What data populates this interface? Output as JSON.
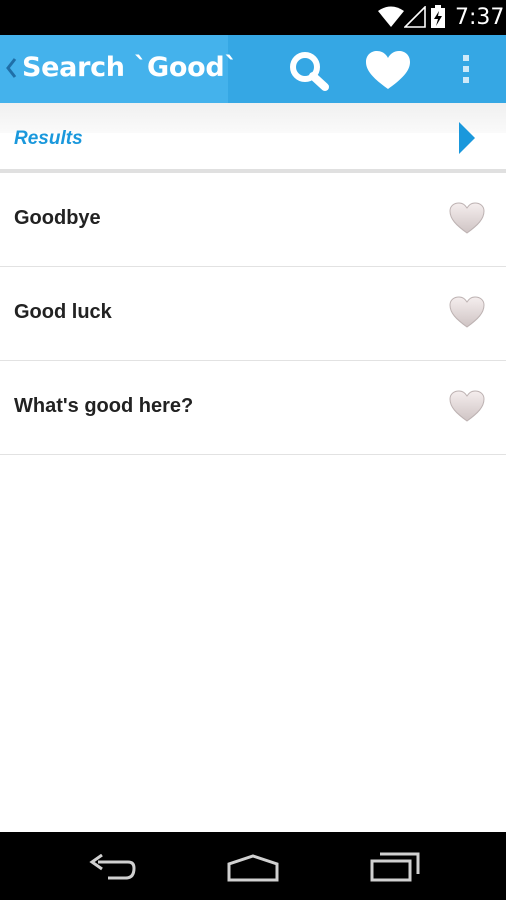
{
  "status_bar": {
    "time": "7:37",
    "icons": [
      "wifi-icon",
      "signal-icon",
      "battery-charging-icon"
    ]
  },
  "action_bar": {
    "title": "Search `Good`",
    "actions": [
      "search-icon",
      "heart-icon",
      "overflow-menu-icon"
    ],
    "background_color": "#35a7e4"
  },
  "results": {
    "label": "Results",
    "accent_color": "#1a98dc",
    "items": [
      {
        "phrase": "Goodbye"
      },
      {
        "phrase": "Good luck"
      },
      {
        "phrase": "What's good here?"
      }
    ]
  },
  "nav_bar": {
    "buttons": [
      "back-icon",
      "home-icon",
      "recents-icon"
    ]
  }
}
